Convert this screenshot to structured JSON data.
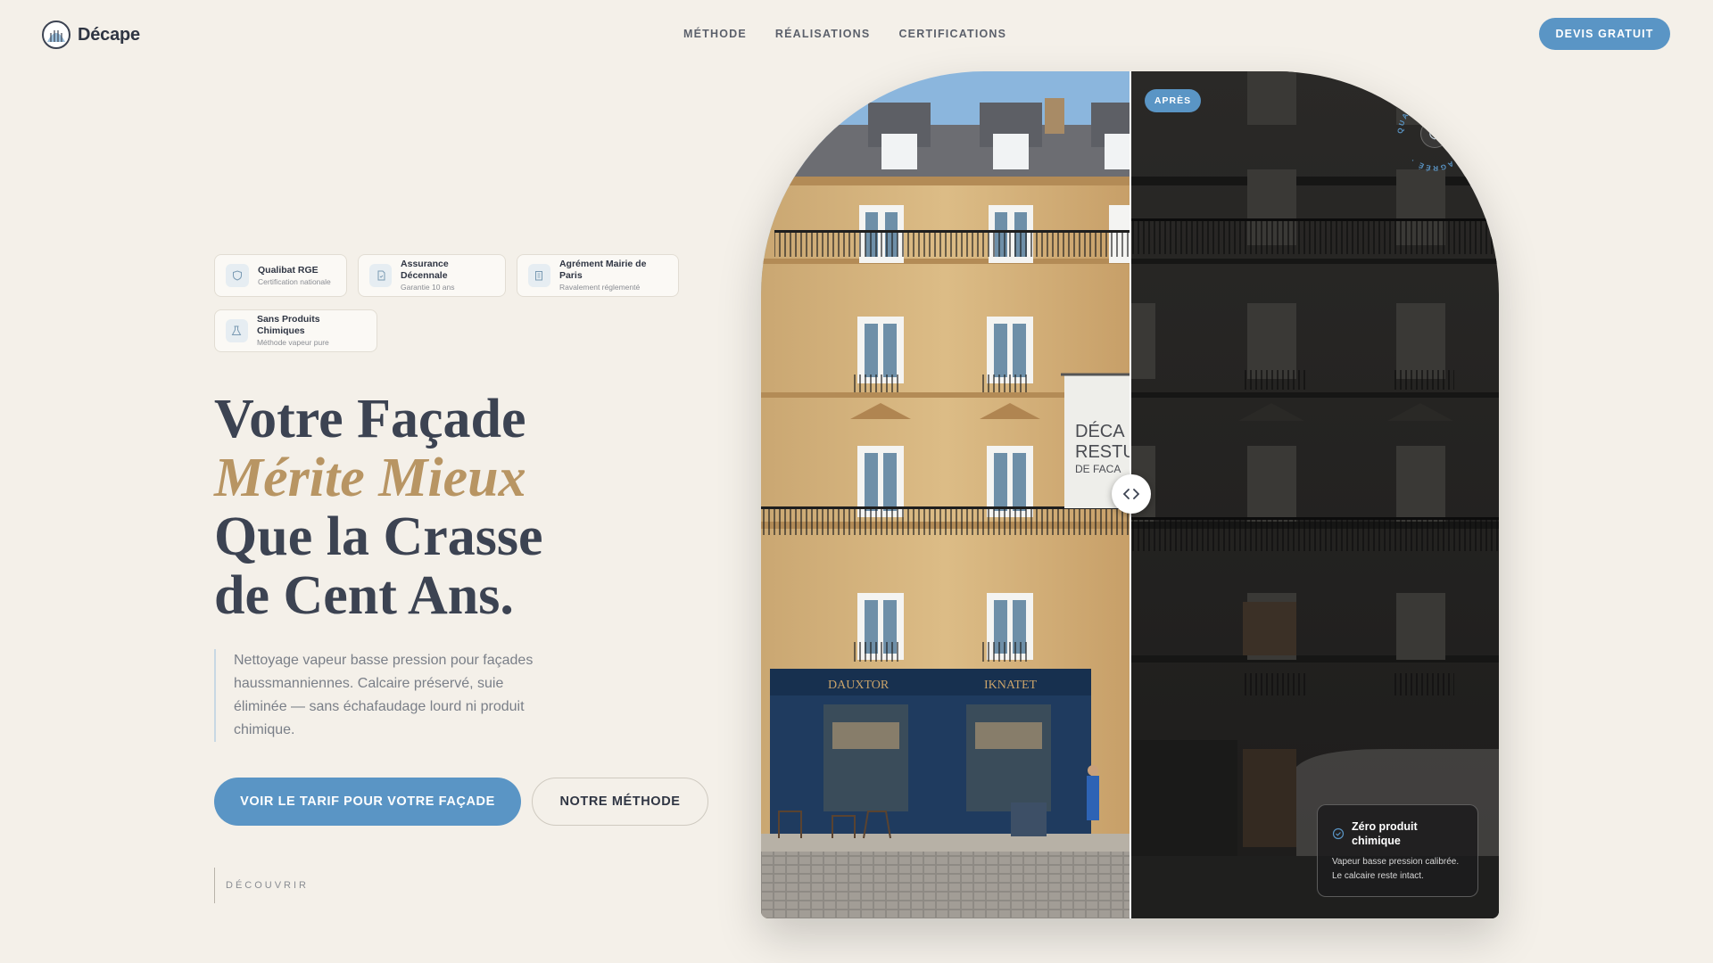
{
  "nav": {
    "logo_text": "Décape",
    "links": [
      "MÉTHODE",
      "RÉALISATIONS",
      "CERTIFICATIONS"
    ],
    "cta_label": "DEVIS GRATUIT"
  },
  "badges": [
    {
      "title": "Qualibat RGE",
      "subtitle": "Certification nationale",
      "icon": "shield-icon"
    },
    {
      "title": "Assurance Décennale",
      "subtitle": "Garantie 10 ans",
      "icon": "document-icon"
    },
    {
      "title": "Agrément Mairie de Paris",
      "subtitle": "Ravalement réglementé",
      "icon": "building-icon"
    },
    {
      "title": "Sans Produits Chimiques",
      "subtitle": "Méthode vapeur pure",
      "icon": "flask-icon"
    }
  ],
  "hero": {
    "line1": "Votre Façade",
    "line2": "Mérite Mieux",
    "line3": "Que la Crasse",
    "line4": "de Cent Ans.",
    "lead": "Nettoyage vapeur basse pression pour façades haussmanniennes. Calcaire préservé, suie éliminée — sans échafaudage lourd ni produit chimique.",
    "primary_cta": "VOIR LE TARIF POUR VOTRE FAÇADE",
    "secondary_cta": "NOTRE MÉTHODE",
    "discover": "DÉCOUVRIR"
  },
  "comparison": {
    "after_label": "APRÈS",
    "seal_text": "QUALIBAT RGE · PARIS · AGRÉÉ ·",
    "info_title": "Zéro produit chimique",
    "info_desc": "Vapeur basse pression calibrée. Le calcaire reste intact.",
    "banner_text": [
      "DÉCA",
      "RESTU",
      "DE FACA"
    ],
    "shop_signs": [
      "DAUXTOR",
      "IKNATET"
    ]
  },
  "colors": {
    "accent_blue": "#5a95c5",
    "gold": "#b89563",
    "background": "#f4f0e9",
    "text": "#3c4352"
  }
}
